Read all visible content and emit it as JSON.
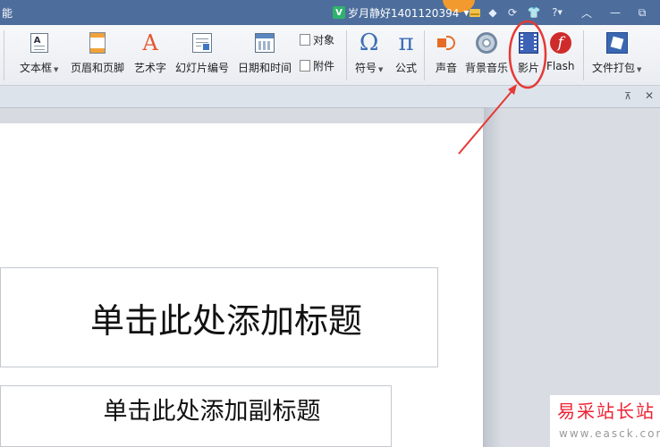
{
  "titlebar": {
    "app_title": "能",
    "user_name": "岁月静好1401120394",
    "help": "?"
  },
  "ribbon": {
    "textbox": "文本框",
    "header_footer": "页眉和页脚",
    "wordart": "艺术字",
    "slide_number": "幻灯片编号",
    "datetime": "日期和时间",
    "object": "对象",
    "attachment": "附件",
    "symbol": "符号",
    "formula": "公式",
    "sound": "声音",
    "bg_music": "背景音乐",
    "movie": "影片",
    "flash": "Flash",
    "file_pack": "文件打包"
  },
  "slide": {
    "title_placeholder": "单击此处添加标题",
    "subtitle_placeholder": "单击此处添加副标题"
  },
  "watermark": {
    "site_name": "易采站长站",
    "site_url": "www.easck.com"
  },
  "colors": {
    "titlebar": "#4d6e9c",
    "annotation": "#e53935"
  }
}
